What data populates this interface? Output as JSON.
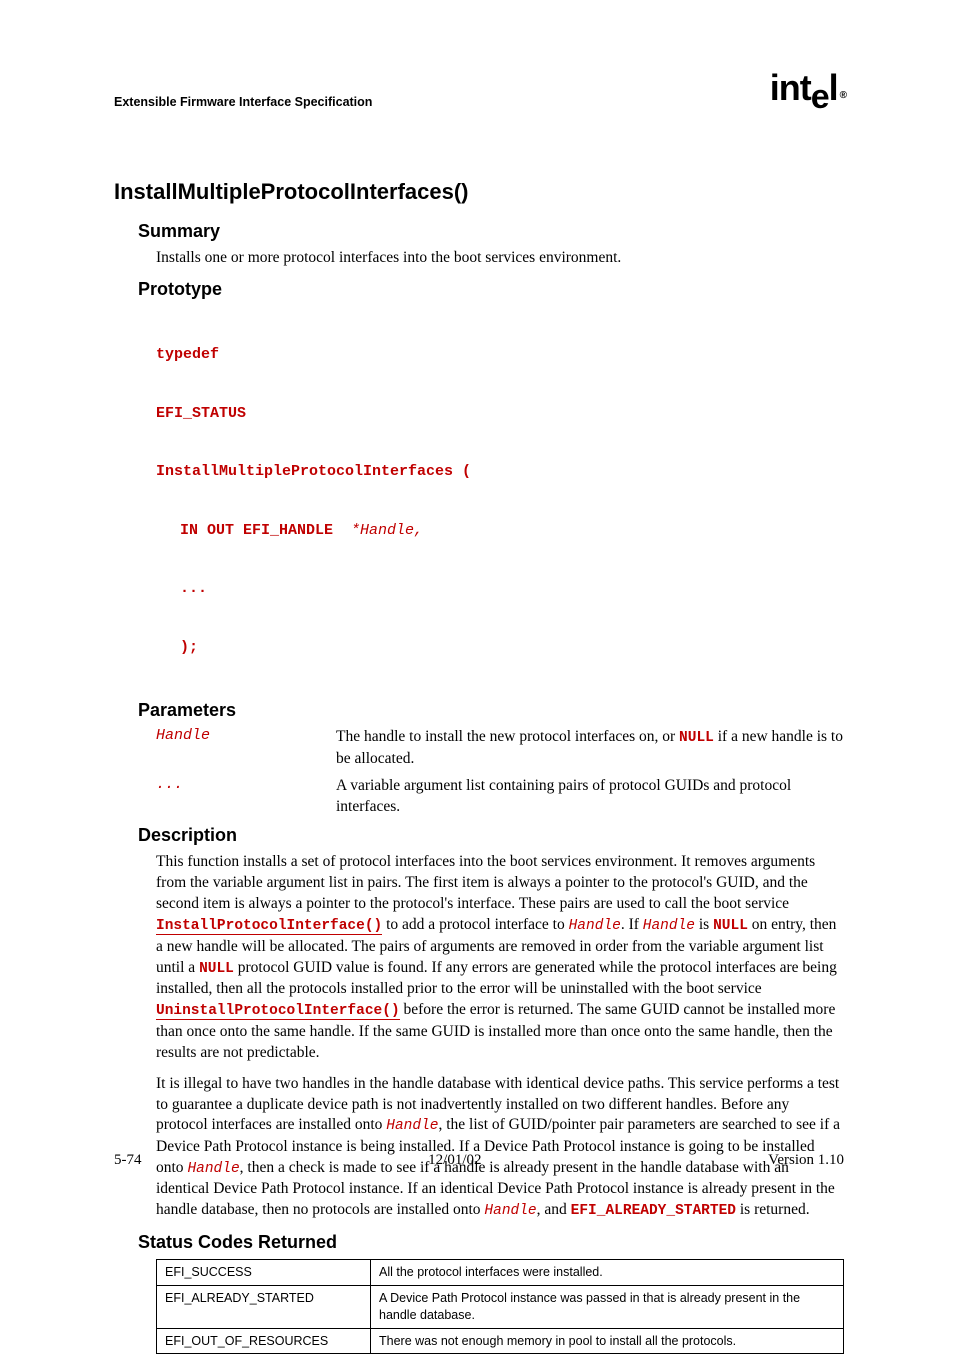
{
  "header": {
    "title": "Extensible Firmware Interface Specification",
    "logo": "intel"
  },
  "main_heading": "InstallMultipleProtocolInterfaces()",
  "summary": {
    "heading": "Summary",
    "text": "Installs one or more protocol interfaces into the boot services environment."
  },
  "prototype": {
    "heading": "Prototype",
    "lines": {
      "l1": "typedef",
      "l2": "EFI_STATUS",
      "l3": "InstallMultipleProtocolInterfaces (",
      "l4a": "IN OUT EFI_HANDLE  ",
      "l4b": "*Handle,",
      "l5": "...",
      "l6": ");"
    }
  },
  "parameters": {
    "heading": "Parameters",
    "rows": [
      {
        "name": "Handle",
        "desc_pre": "The handle to install the new protocol interfaces on, or ",
        "desc_null": "NULL",
        "desc_post": " if a new handle is to be allocated."
      },
      {
        "name": "...",
        "desc_pre": "A variable argument list containing pairs of protocol GUIDs and protocol interfaces.",
        "desc_null": "",
        "desc_post": ""
      }
    ]
  },
  "description": {
    "heading": "Description",
    "p1": {
      "t1": "This function installs a set of protocol interfaces into the boot services environment.  It removes arguments from the variable argument list in pairs.  The first item is always a pointer to the protocol's GUID, and the second item is always a pointer to the protocol's interface.  These pairs are used to call the boot service ",
      "link1": "InstallProtocolInterface()",
      "t2": " to add a protocol interface to ",
      "h1": "Handle",
      "t3": ".  If ",
      "h2": "Handle",
      "t4": " is ",
      "null1": "NULL",
      "t5": " on entry, then a new handle will be allocated.  The pairs of arguments are removed in order from the variable argument list until a ",
      "null2": "NULL",
      "t6": " protocol GUID value is found.  If any errors are generated while the protocol interfaces are being installed, then all the protocols installed prior to the error will be uninstalled with the boot service ",
      "link2": "UninstallProtocolInterface()",
      "t7": " before the error is returned.  The same GUID cannot be installed more than once onto the same handle.  If the same GUID is installed more than once onto the same handle, then the results are not predictable."
    },
    "p2": {
      "t1": "It is illegal to have two handles in the handle database with identical device paths.  This service performs a test to guarantee a duplicate device path is not inadvertently installed on two different handles.  Before any protocol interfaces are installed onto ",
      "h1": "Handle",
      "t2": ", the list of GUID/pointer pair parameters are searched to see if a Device Path Protocol instance is being installed.  If a Device Path Protocol instance is going to be installed onto ",
      "h2": "Handle",
      "t3": ", then a check is made to see if a handle is already present in the handle database with an identical Device Path Protocol instance.  If an identical Device Path Protocol instance is already present in the handle database, then no protocols are installed onto ",
      "h3": "Handle",
      "t4": ", and ",
      "c1": "EFI_ALREADY_STARTED",
      "t5": " is returned."
    }
  },
  "status": {
    "heading": "Status Codes Returned",
    "rows": [
      {
        "code": "EFI_SUCCESS",
        "desc": "All the protocol interfaces were installed."
      },
      {
        "code": "EFI_ALREADY_STARTED",
        "desc": "A Device Path Protocol instance was passed in that is already present in the handle database."
      },
      {
        "code": "EFI_OUT_OF_RESOURCES",
        "desc": "There was not enough memory in pool to install all the protocols."
      }
    ]
  },
  "footer": {
    "left": "5-74",
    "center": "12/01/02",
    "right": "Version 1.10"
  }
}
